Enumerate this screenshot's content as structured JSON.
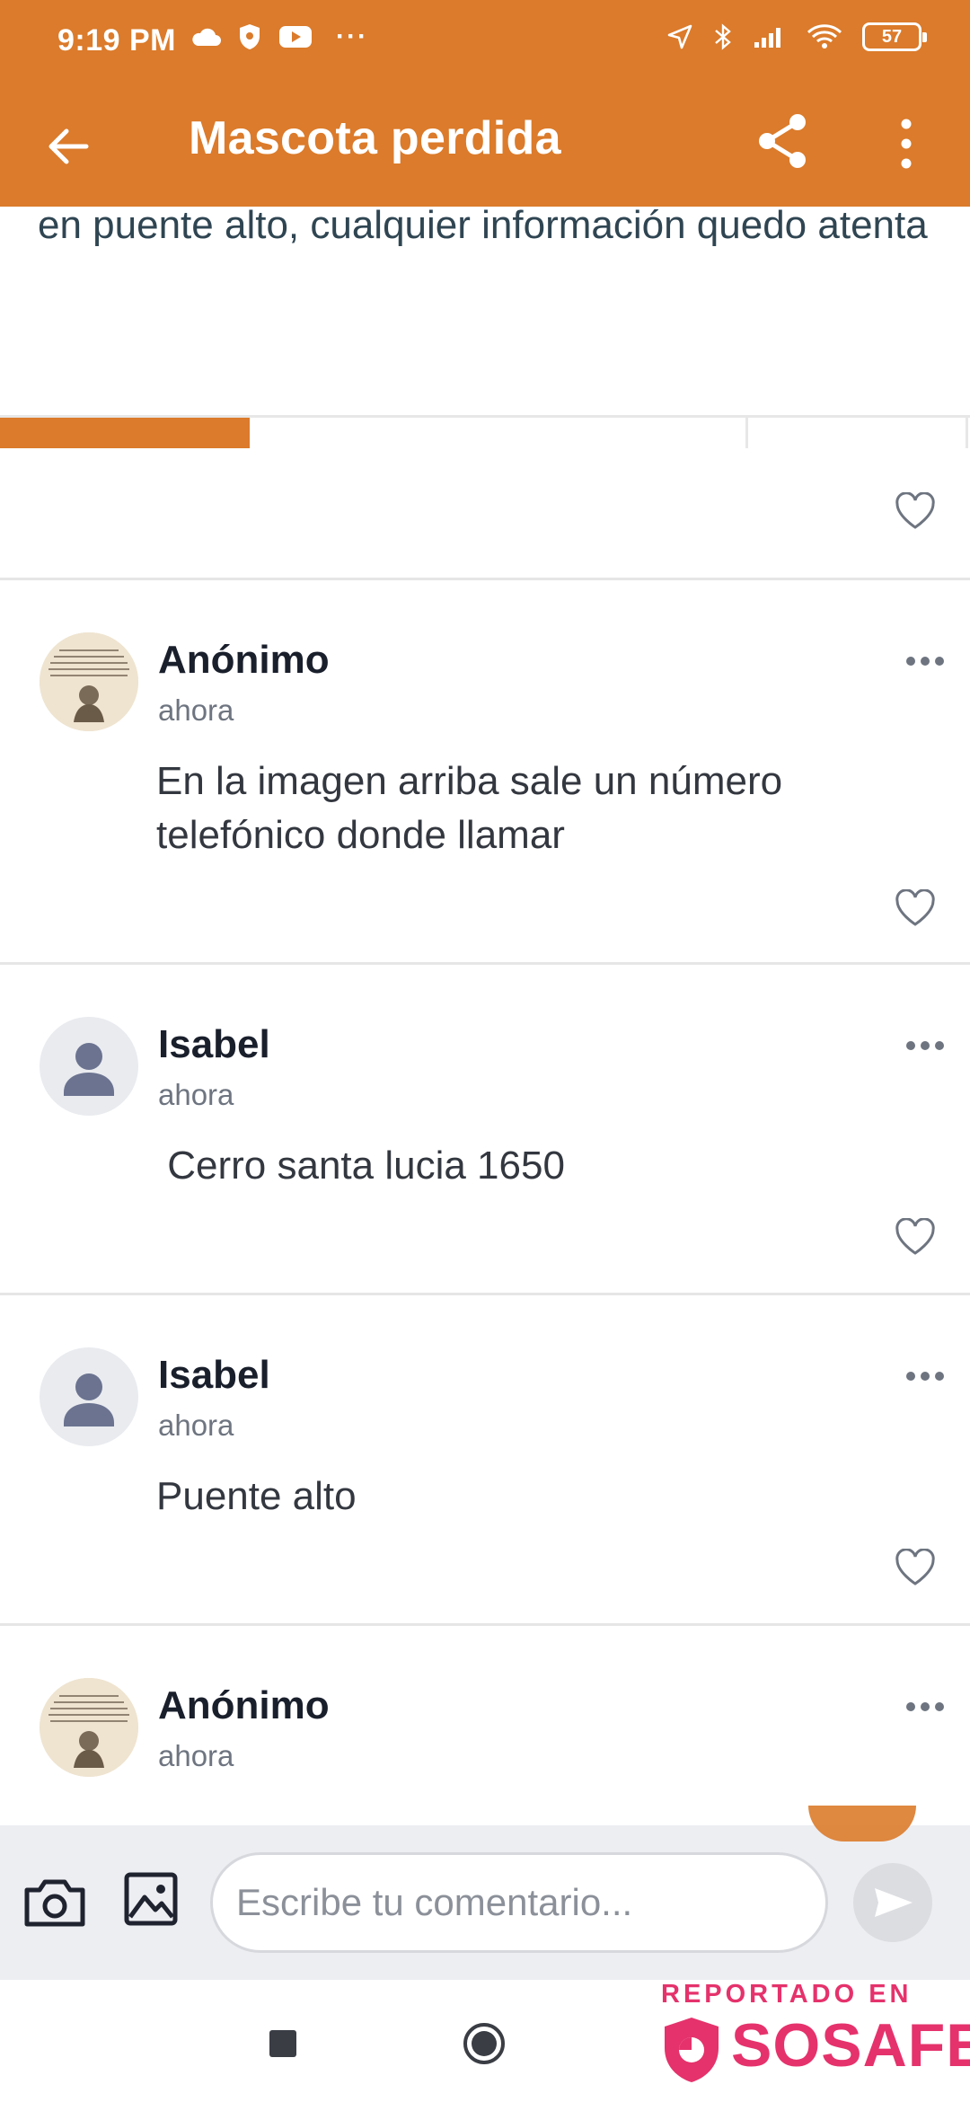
{
  "status_bar": {
    "time": "9:19 PM",
    "battery": "57"
  },
  "toolbar": {
    "title": "Mascota perdida"
  },
  "post": {
    "description": "en puente alto, cualquier información quedo atenta"
  },
  "comments": [
    {
      "author": "Anónimo",
      "time": "ahora",
      "text": "En la imagen arriba sale un número telefónico donde llamar",
      "avatar": "image"
    },
    {
      "author": "Isabel",
      "time": "ahora",
      "text": " Cerro santa lucia 1650",
      "avatar": "default"
    },
    {
      "author": "Isabel",
      "time": "ahora",
      "text": "Puente alto",
      "avatar": "default"
    },
    {
      "author": "Anónimo",
      "time": "ahora",
      "text": "",
      "avatar": "image"
    }
  ],
  "comment_input": {
    "placeholder": "Escribe tu comentario..."
  },
  "watermark": {
    "top": "REPORTADO EN",
    "brand": "SOSAFE"
  },
  "colors": {
    "accent": "#DB7B2B",
    "brand": "#E5326C"
  }
}
